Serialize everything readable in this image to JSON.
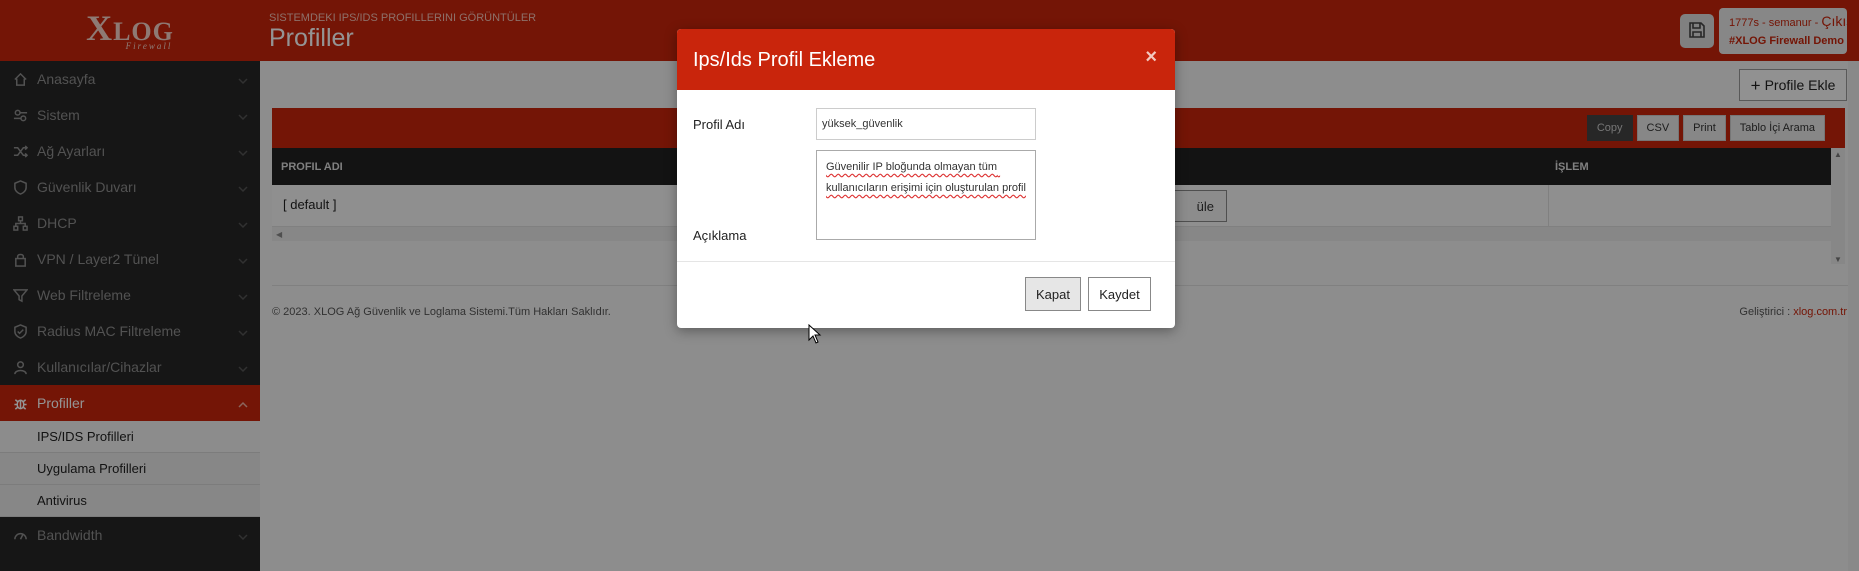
{
  "logo": {
    "main_big": "X",
    "main_rest": "LOG",
    "sub": "Firewall"
  },
  "sidebar": {
    "items": [
      {
        "label": "Anasayfa",
        "icon": "home-icon"
      },
      {
        "label": "Sistem",
        "icon": "settings-icon"
      },
      {
        "label": "Ağ Ayarları",
        "icon": "shuffle-icon"
      },
      {
        "label": "Güvenlik Duvarı",
        "icon": "shield-icon"
      },
      {
        "label": "DHCP",
        "icon": "network-icon"
      },
      {
        "label": "VPN / Layer2 Tünel",
        "icon": "lock-icon"
      },
      {
        "label": "Web Filtreleme",
        "icon": "filter-icon"
      },
      {
        "label": "Radius MAC Filtreleme",
        "icon": "shield-check-icon"
      },
      {
        "label": "Kullanıcılar/Cihazlar",
        "icon": "user-icon"
      },
      {
        "label": "Profiller",
        "icon": "bug-icon"
      },
      {
        "label": "Bandwidth",
        "icon": "gauge-icon"
      }
    ],
    "subitems": [
      {
        "label": "IPS/IDS Profilleri"
      },
      {
        "label": "Uygulama Profilleri"
      },
      {
        "label": "Antivirus"
      }
    ]
  },
  "header": {
    "subtitle": "SISTEMDEKI IPS/IDS PROFILLERINI GÖRÜNTÜLER",
    "title": "Profiller",
    "user": "1777s - semanur",
    "logout": "Çıkış",
    "org": "#XLOG Firewall Demo"
  },
  "main": {
    "add_button": "Profile Ekle",
    "tools": [
      "Copy",
      "CSV",
      "Print",
      "Tablo İçi Arama"
    ],
    "columns": [
      "PROFIL ADI",
      "İŞLEM"
    ],
    "rows": [
      {
        "name": "[ default ]",
        "action": "üle"
      }
    ]
  },
  "footer": {
    "copyright": "© 2023. XLOG Ağ Güvenlik ve Loglama Sistemi.Tüm Hakları Saklıdır.",
    "dev_label": "Geliştirici :",
    "dev_link": "xlog.com.tr"
  },
  "modal": {
    "title": "Ips/Ids Profil Ekleme",
    "close_symbol": "×",
    "name_label": "Profil Adı",
    "name_value": "yüksek_güvenlik",
    "desc_label": "Açıklama",
    "desc_value": "Güvenilir IP bloğunda olmayan tüm kullanıcıların erişimi için oluşturulan profil",
    "close_button": "Kapat",
    "save_button": "Kaydet"
  },
  "colors": {
    "brand": "#c9250c",
    "sidebar": "#262626"
  }
}
